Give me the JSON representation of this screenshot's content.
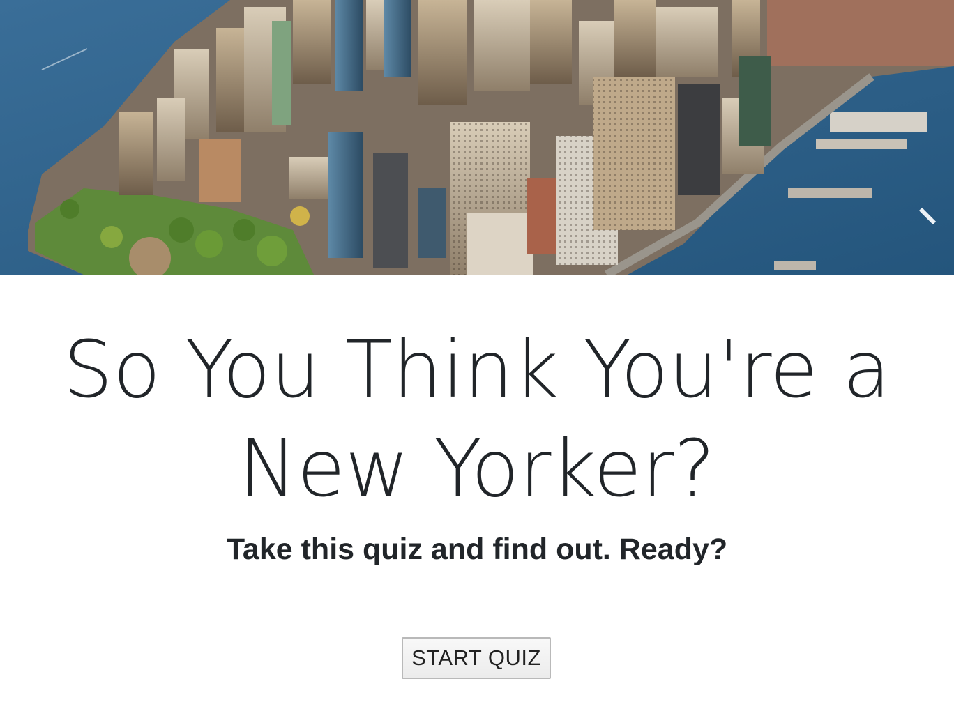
{
  "hero": {
    "image_subject": "aerial-view-lower-manhattan-skyline"
  },
  "quiz": {
    "title": "So You Think You're a New Yorker?",
    "subtitle": "Take this quiz and find out. Ready?",
    "start_label": "START QUIZ"
  },
  "colors": {
    "text": "#212529",
    "water": "#2f5f86",
    "button_border": "#b9b9b9",
    "button_bg": "#f0f0f0"
  }
}
